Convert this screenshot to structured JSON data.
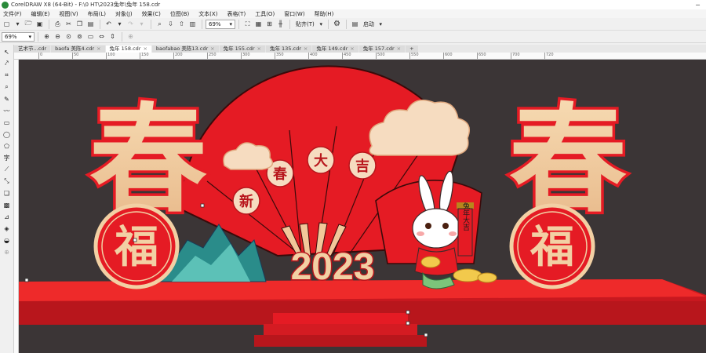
{
  "window": {
    "title": "CorelDRAW X8 (64-Bit) - F:\\0 HT\\2023兔年\\兔年 158.cdr"
  },
  "menu": [
    "文件(F)",
    "编辑(E)",
    "视图(V)",
    "布局(L)",
    "对象(J)",
    "效果(C)",
    "位图(B)",
    "文本(X)",
    "表格(T)",
    "工具(O)",
    "窗口(W)",
    "帮助(H)"
  ],
  "toolbar": {
    "zoom_value": "69%",
    "snap_label": "贴齐(T)",
    "launch_label": "启动"
  },
  "propertybar": {
    "zoom_value": "69%"
  },
  "tabs": [
    {
      "label": "艺术节...cdr",
      "active": false
    },
    {
      "label": "baofa 美陈4.cdr",
      "active": false
    },
    {
      "label": "兔年 158.cdr",
      "active": true
    },
    {
      "label": "baofabao 美陈13.cdr",
      "active": false
    },
    {
      "label": "兔年 155.cdr",
      "active": false
    },
    {
      "label": "兔年 135.cdr",
      "active": false
    },
    {
      "label": "兔年 149.cdr",
      "active": false
    },
    {
      "label": "兔年 157.cdr",
      "active": false
    }
  ],
  "ruler_ticks": [
    "0",
    "50",
    "100",
    "150",
    "200",
    "250",
    "300",
    "350",
    "400",
    "450",
    "500",
    "550",
    "600",
    "650",
    "700",
    "720"
  ],
  "artwork": {
    "big_char": "春",
    "fu_char": "福",
    "fan_chars": [
      "新",
      "春",
      "大",
      "吉"
    ],
    "year": "2023",
    "scroll_text": "兔年大吉",
    "colors": {
      "red": "#e51b24",
      "gold": "#f2d0a4",
      "dark_red": "#b8161c",
      "bg": "#3b3536"
    }
  }
}
